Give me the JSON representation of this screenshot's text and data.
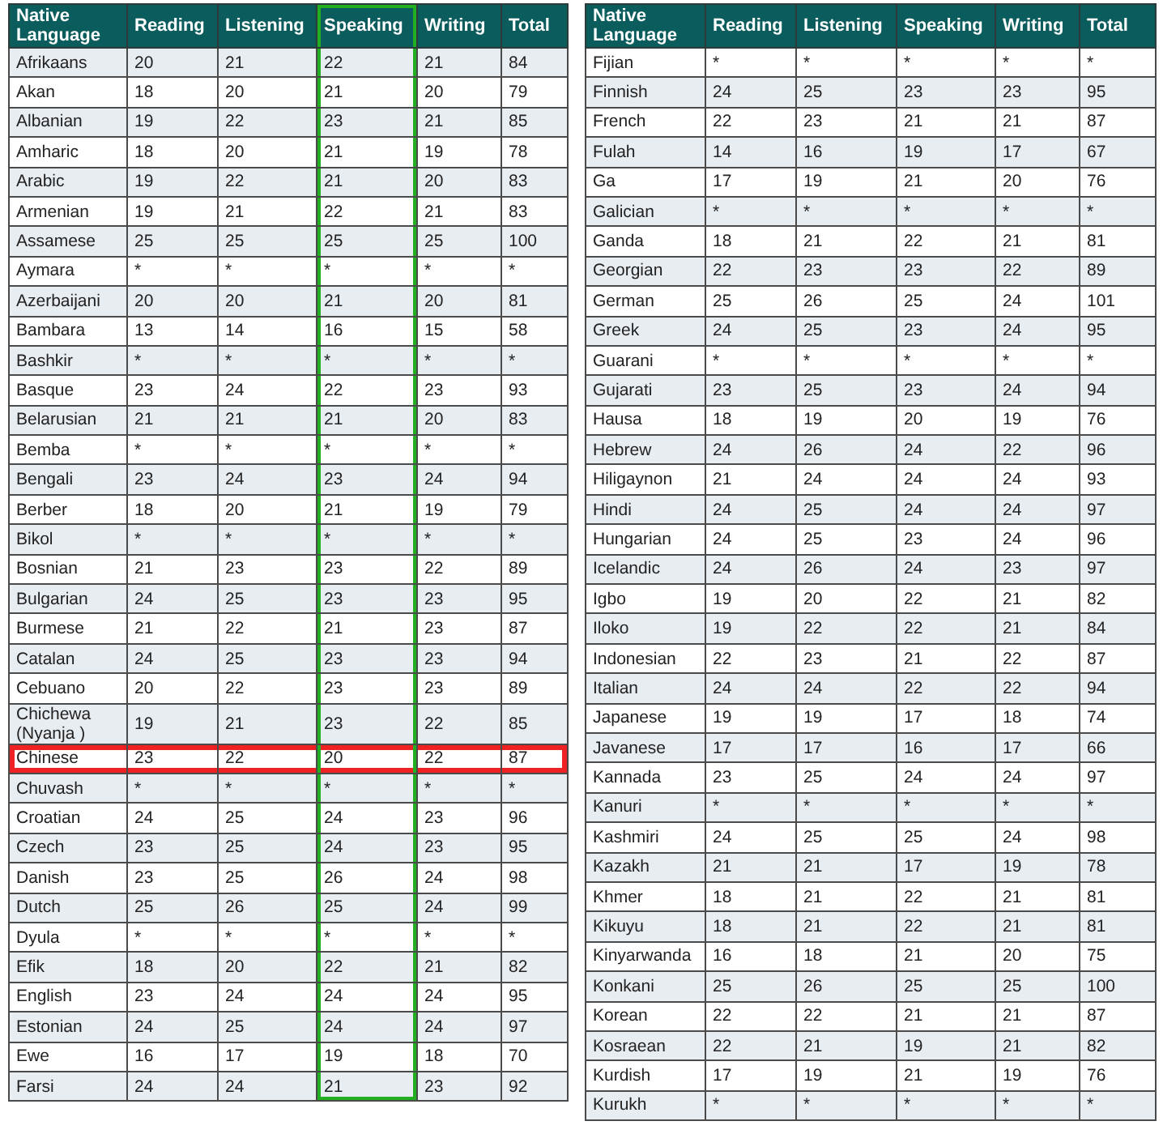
{
  "tables": [
    {
      "first_row_shaded": true,
      "columns": [
        {
          "label": "Native Language",
          "highlighted": false
        },
        {
          "label": "Reading",
          "highlighted": false
        },
        {
          "label": "Listening",
          "highlighted": false
        },
        {
          "label": "Speaking",
          "highlighted": true
        },
        {
          "label": "Writing",
          "highlighted": false
        },
        {
          "label": "Total",
          "highlighted": false
        }
      ],
      "rows": [
        {
          "cells": [
            "Afrikaans",
            "20",
            "21",
            "22",
            "21",
            "84"
          ],
          "highlighted": false
        },
        {
          "cells": [
            "Akan",
            "18",
            "20",
            "21",
            "20",
            "79"
          ],
          "highlighted": false
        },
        {
          "cells": [
            "Albanian",
            "19",
            "22",
            "23",
            "21",
            "85"
          ],
          "highlighted": false
        },
        {
          "cells": [
            "Amharic",
            "18",
            "20",
            "21",
            "19",
            "78"
          ],
          "highlighted": false
        },
        {
          "cells": [
            "Arabic",
            "19",
            "22",
            "21",
            "20",
            "83"
          ],
          "highlighted": false
        },
        {
          "cells": [
            "Armenian",
            "19",
            "21",
            "22",
            "21",
            "83"
          ],
          "highlighted": false
        },
        {
          "cells": [
            "Assamese",
            "25",
            "25",
            "25",
            "25",
            "100"
          ],
          "highlighted": false
        },
        {
          "cells": [
            "Aymara",
            "*",
            "*",
            "*",
            "*",
            "*"
          ],
          "highlighted": false
        },
        {
          "cells": [
            "Azerbaijani",
            "20",
            "20",
            "21",
            "20",
            "81"
          ],
          "highlighted": false
        },
        {
          "cells": [
            "Bambara",
            "13",
            "14",
            "16",
            "15",
            "58"
          ],
          "highlighted": false
        },
        {
          "cells": [
            "Bashkir",
            "*",
            "*",
            "*",
            "*",
            "*"
          ],
          "highlighted": false
        },
        {
          "cells": [
            "Basque",
            "23",
            "24",
            "22",
            "23",
            "93"
          ],
          "highlighted": false
        },
        {
          "cells": [
            "Belarusian",
            "21",
            "21",
            "21",
            "20",
            "83"
          ],
          "highlighted": false
        },
        {
          "cells": [
            "Bemba",
            "*",
            "*",
            "*",
            "*",
            "*"
          ],
          "highlighted": false
        },
        {
          "cells": [
            "Bengali",
            "23",
            "24",
            "23",
            "24",
            "94"
          ],
          "highlighted": false
        },
        {
          "cells": [
            "Berber",
            "18",
            "20",
            "21",
            "19",
            "79"
          ],
          "highlighted": false
        },
        {
          "cells": [
            "Bikol",
            "*",
            "*",
            "*",
            "*",
            "*"
          ],
          "highlighted": false
        },
        {
          "cells": [
            "Bosnian",
            "21",
            "23",
            "23",
            "22",
            "89"
          ],
          "highlighted": false
        },
        {
          "cells": [
            "Bulgarian",
            "24",
            "25",
            "23",
            "23",
            "95"
          ],
          "highlighted": false
        },
        {
          "cells": [
            "Burmese",
            "21",
            "22",
            "21",
            "23",
            "87"
          ],
          "highlighted": false
        },
        {
          "cells": [
            "Catalan",
            "24",
            "25",
            "23",
            "23",
            "94"
          ],
          "highlighted": false
        },
        {
          "cells": [
            "Cebuano",
            "20",
            "22",
            "23",
            "23",
            "89"
          ],
          "highlighted": false
        },
        {
          "cells": [
            "Chichewa (Nyanja )",
            "19",
            "21",
            "23",
            "22",
            "85"
          ],
          "highlighted": false
        },
        {
          "cells": [
            "Chinese",
            "23",
            "22",
            "20",
            "22",
            "87"
          ],
          "highlighted": true
        },
        {
          "cells": [
            "Chuvash",
            "*",
            "*",
            "*",
            "*",
            "*"
          ],
          "highlighted": false
        },
        {
          "cells": [
            "Croatian",
            "24",
            "25",
            "24",
            "23",
            "96"
          ],
          "highlighted": false
        },
        {
          "cells": [
            "Czech",
            "23",
            "25",
            "24",
            "23",
            "95"
          ],
          "highlighted": false
        },
        {
          "cells": [
            "Danish",
            "23",
            "25",
            "26",
            "24",
            "98"
          ],
          "highlighted": false
        },
        {
          "cells": [
            "Dutch",
            "25",
            "26",
            "25",
            "24",
            "99"
          ],
          "highlighted": false
        },
        {
          "cells": [
            "Dyula",
            "*",
            "*",
            "*",
            "*",
            "*"
          ],
          "highlighted": false
        },
        {
          "cells": [
            "Efik",
            "18",
            "20",
            "22",
            "21",
            "82"
          ],
          "highlighted": false
        },
        {
          "cells": [
            "English",
            "23",
            "24",
            "24",
            "24",
            "95"
          ],
          "highlighted": false
        },
        {
          "cells": [
            "Estonian",
            "24",
            "25",
            "24",
            "24",
            "97"
          ],
          "highlighted": false
        },
        {
          "cells": [
            "Ewe",
            "16",
            "17",
            "19",
            "18",
            "70"
          ],
          "highlighted": false
        },
        {
          "cells": [
            "Farsi",
            "24",
            "24",
            "21",
            "23",
            "92"
          ],
          "highlighted": false
        }
      ]
    },
    {
      "first_row_shaded": false,
      "columns": [
        {
          "label": "Native Language",
          "highlighted": false
        },
        {
          "label": "Reading",
          "highlighted": false
        },
        {
          "label": "Listening",
          "highlighted": false
        },
        {
          "label": "Speaking",
          "highlighted": false
        },
        {
          "label": "Writing",
          "highlighted": false
        },
        {
          "label": "Total",
          "highlighted": false
        }
      ],
      "rows": [
        {
          "cells": [
            "Fijian",
            "*",
            "*",
            "*",
            "*",
            "*"
          ],
          "highlighted": false
        },
        {
          "cells": [
            "Finnish",
            "24",
            "25",
            "23",
            "23",
            "95"
          ],
          "highlighted": false
        },
        {
          "cells": [
            "French",
            "22",
            "23",
            "21",
            "21",
            "87"
          ],
          "highlighted": false
        },
        {
          "cells": [
            "Fulah",
            "14",
            "16",
            "19",
            "17",
            "67"
          ],
          "highlighted": false
        },
        {
          "cells": [
            "Ga",
            "17",
            "19",
            "21",
            "20",
            "76"
          ],
          "highlighted": false
        },
        {
          "cells": [
            "Galician",
            "*",
            "*",
            "*",
            "*",
            "*"
          ],
          "highlighted": false
        },
        {
          "cells": [
            "Ganda",
            "18",
            "21",
            "22",
            "21",
            "81"
          ],
          "highlighted": false
        },
        {
          "cells": [
            "Georgian",
            "22",
            "23",
            "23",
            "22",
            "89"
          ],
          "highlighted": false
        },
        {
          "cells": [
            "German",
            "25",
            "26",
            "25",
            "24",
            "101"
          ],
          "highlighted": false
        },
        {
          "cells": [
            "Greek",
            "24",
            "25",
            "23",
            "24",
            "95"
          ],
          "highlighted": false
        },
        {
          "cells": [
            "Guarani",
            "*",
            "*",
            "*",
            "*",
            "*"
          ],
          "highlighted": false
        },
        {
          "cells": [
            "Gujarati",
            "23",
            "25",
            "23",
            "24",
            "94"
          ],
          "highlighted": false
        },
        {
          "cells": [
            "Hausa",
            "18",
            "19",
            "20",
            "19",
            "76"
          ],
          "highlighted": false
        },
        {
          "cells": [
            "Hebrew",
            "24",
            "26",
            "24",
            "22",
            "96"
          ],
          "highlighted": false
        },
        {
          "cells": [
            "Hiligaynon",
            "21",
            "24",
            "24",
            "24",
            "93"
          ],
          "highlighted": false
        },
        {
          "cells": [
            "Hindi",
            "24",
            "25",
            "24",
            "24",
            "97"
          ],
          "highlighted": false
        },
        {
          "cells": [
            "Hungarian",
            "24",
            "25",
            "23",
            "24",
            "96"
          ],
          "highlighted": false
        },
        {
          "cells": [
            "Icelandic",
            "24",
            "26",
            "24",
            "23",
            "97"
          ],
          "highlighted": false
        },
        {
          "cells": [
            "Igbo",
            "19",
            "20",
            "22",
            "21",
            "82"
          ],
          "highlighted": false
        },
        {
          "cells": [
            "Iloko",
            "19",
            "22",
            "22",
            "21",
            "84"
          ],
          "highlighted": false
        },
        {
          "cells": [
            "Indonesian",
            "22",
            "23",
            "21",
            "22",
            "87"
          ],
          "highlighted": false
        },
        {
          "cells": [
            "Italian",
            "24",
            "24",
            "22",
            "22",
            "94"
          ],
          "highlighted": false
        },
        {
          "cells": [
            "Japanese",
            "19",
            "19",
            "17",
            "18",
            "74"
          ],
          "highlighted": false
        },
        {
          "cells": [
            "Javanese",
            "17",
            "17",
            "16",
            "17",
            "66"
          ],
          "highlighted": false
        },
        {
          "cells": [
            "Kannada",
            "23",
            "25",
            "24",
            "24",
            "97"
          ],
          "highlighted": false
        },
        {
          "cells": [
            "Kanuri",
            "*",
            "*",
            "*",
            "*",
            "*"
          ],
          "highlighted": false
        },
        {
          "cells": [
            "Kashmiri",
            "24",
            "25",
            "25",
            "24",
            "98"
          ],
          "highlighted": false
        },
        {
          "cells": [
            "Kazakh",
            "21",
            "21",
            "17",
            "19",
            "78"
          ],
          "highlighted": false
        },
        {
          "cells": [
            "Khmer",
            "18",
            "21",
            "22",
            "21",
            "81"
          ],
          "highlighted": false
        },
        {
          "cells": [
            "Kikuyu",
            "18",
            "21",
            "22",
            "21",
            "81"
          ],
          "highlighted": false
        },
        {
          "cells": [
            "Kinyarwanda",
            "16",
            "18",
            "21",
            "20",
            "75"
          ],
          "highlighted": false
        },
        {
          "cells": [
            "Konkani",
            "25",
            "26",
            "25",
            "25",
            "100"
          ],
          "highlighted": false
        },
        {
          "cells": [
            "Korean",
            "22",
            "22",
            "21",
            "21",
            "87"
          ],
          "highlighted": false
        },
        {
          "cells": [
            "Kosraean",
            "22",
            "21",
            "19",
            "21",
            "82"
          ],
          "highlighted": false
        },
        {
          "cells": [
            "Kurdish",
            "17",
            "19",
            "21",
            "19",
            "76"
          ],
          "highlighted": false
        },
        {
          "cells": [
            "Kurukh",
            "*",
            "*",
            "*",
            "*",
            "*"
          ],
          "highlighted": false
        }
      ]
    }
  ]
}
